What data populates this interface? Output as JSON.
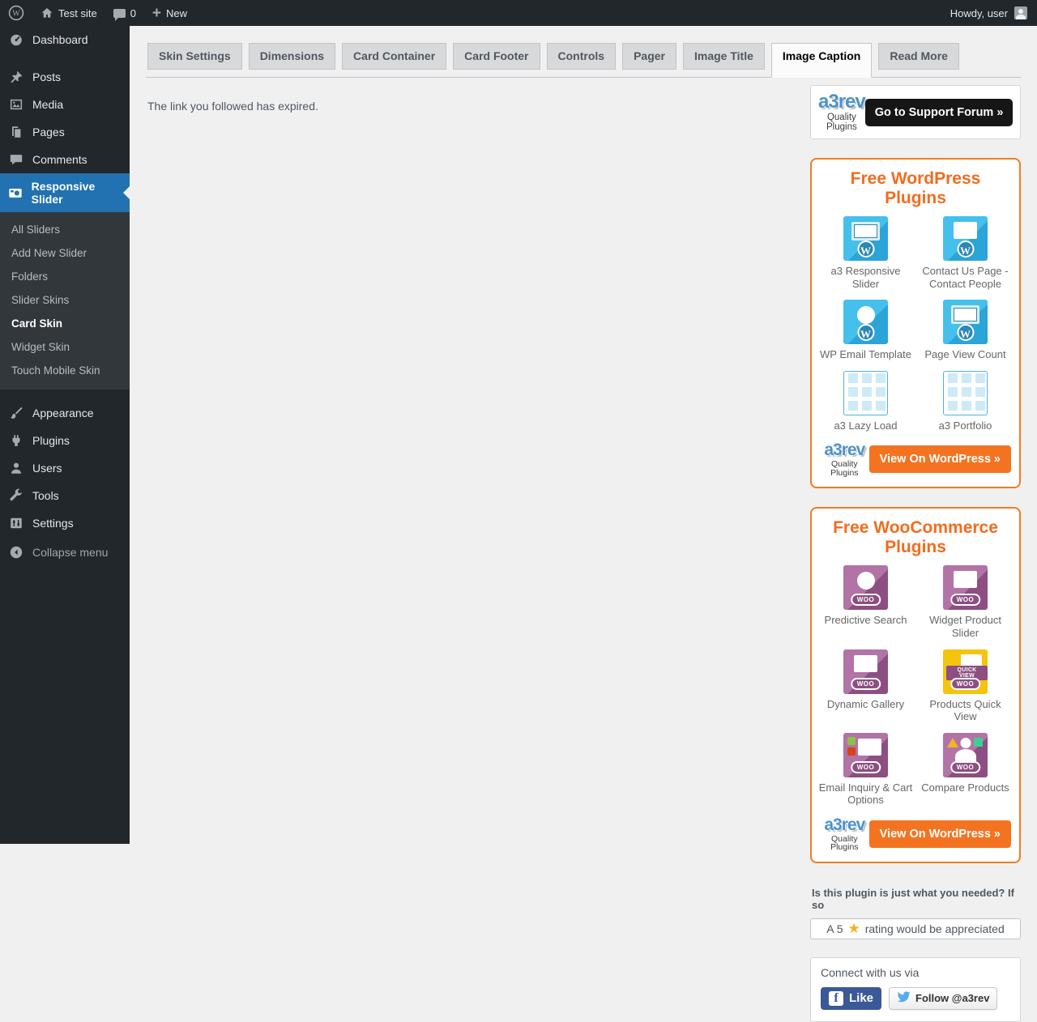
{
  "admin_bar": {
    "site_name": "Test site",
    "comments_count": "0",
    "new_label": "New",
    "howdy": "Howdy, user"
  },
  "sidebar": {
    "items": [
      {
        "label": "Dashboard",
        "icon": "dashboard-icon"
      },
      {
        "label": "Posts",
        "icon": "posts-icon"
      },
      {
        "label": "Media",
        "icon": "media-icon"
      },
      {
        "label": "Pages",
        "icon": "pages-icon"
      },
      {
        "label": "Comments",
        "icon": "comments-icon"
      },
      {
        "label": "Responsive Slider",
        "icon": "camera-icon",
        "active": true
      },
      {
        "label": "Appearance",
        "icon": "appearance-icon"
      },
      {
        "label": "Plugins",
        "icon": "plugins-icon"
      },
      {
        "label": "Users",
        "icon": "users-icon"
      },
      {
        "label": "Tools",
        "icon": "tools-icon"
      },
      {
        "label": "Settings",
        "icon": "settings-icon"
      },
      {
        "label": "Collapse menu",
        "icon": "collapse-icon"
      }
    ],
    "submenu": [
      {
        "label": "All Sliders"
      },
      {
        "label": "Add New Slider"
      },
      {
        "label": "Folders"
      },
      {
        "label": "Slider Skins"
      },
      {
        "label": "Card Skin",
        "current": true
      },
      {
        "label": "Widget Skin"
      },
      {
        "label": "Touch Mobile Skin"
      }
    ]
  },
  "tabs": [
    {
      "label": "Skin Settings"
    },
    {
      "label": "Dimensions"
    },
    {
      "label": "Card Container"
    },
    {
      "label": "Card Footer"
    },
    {
      "label": "Controls"
    },
    {
      "label": "Pager"
    },
    {
      "label": "Image Title"
    },
    {
      "label": "Image Caption",
      "active": true
    },
    {
      "label": "Read More"
    }
  ],
  "main": {
    "notice": "The link you followed has expired."
  },
  "promo": {
    "logo": {
      "name": "a3rev",
      "subtitle": "Quality Plugins"
    },
    "support_button": "Go to Support Forum »",
    "wp_box": {
      "title": "Free WordPress Plugins",
      "plugins": [
        {
          "label": "a3 Responsive Slider",
          "icon": "responsive-slider-plugin-icon"
        },
        {
          "label": "Contact Us Page - Contact People",
          "icon": "contact-us-plugin-icon"
        },
        {
          "label": "WP Email Template",
          "icon": "email-template-plugin-icon"
        },
        {
          "label": "Page View Count",
          "icon": "page-view-count-plugin-icon"
        },
        {
          "label": "a3 Lazy Load",
          "icon": "lazy-load-plugin-icon"
        },
        {
          "label": "a3 Portfolio",
          "icon": "portfolio-plugin-icon"
        }
      ],
      "view_button": "View On WordPress »"
    },
    "woo_box": {
      "title": "Free WooCommerce Plugins",
      "plugins": [
        {
          "label": "Predictive Search",
          "icon": "predictive-search-plugin-icon"
        },
        {
          "label": "Widget Product Slider",
          "icon": "widget-product-slider-plugin-icon"
        },
        {
          "label": "Dynamic Gallery",
          "icon": "dynamic-gallery-plugin-icon"
        },
        {
          "label": "Products Quick View",
          "icon": "products-quick-view-plugin-icon"
        },
        {
          "label": "Email Inquiry & Cart Options",
          "icon": "email-inquiry-plugin-icon"
        },
        {
          "label": "Compare Products",
          "icon": "compare-products-plugin-icon"
        }
      ],
      "view_button": "View On WordPress »"
    },
    "rating": {
      "prompt": "Is this plugin is just what you needed? If so",
      "text_before": "A 5",
      "star": "★",
      "text_after": "rating would be appreciated"
    },
    "connect": {
      "title": "Connect with us via",
      "facebook_label": "Like",
      "facebook_f": "f",
      "twitter_label": "Follow @a3rev"
    }
  },
  "colors": {
    "admin_bar_bg": "#22272c",
    "submenu_bg": "#32373c",
    "active_menu_blue": "#2271b1",
    "page_bg": "#f0f0f1",
    "promo_orange": "#f47321",
    "wp_icon_blue": "#35b5e5",
    "woo_purple": "#a46497",
    "quickview_yellow": "#f5c40f",
    "facebook_blue": "#3b5998",
    "twitter_blue": "#55acee",
    "star_gold": "#f5b01d",
    "black_button": "#161616"
  }
}
